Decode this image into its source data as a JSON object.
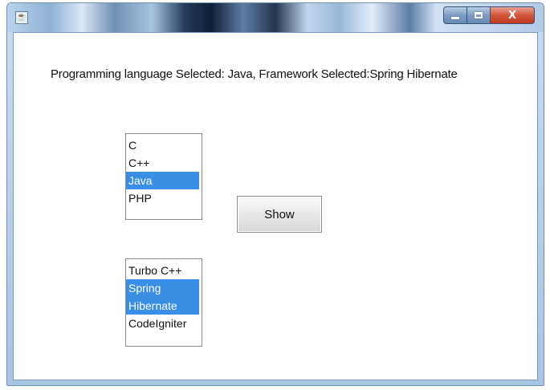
{
  "window": {
    "title_icon": "java-app-icon",
    "controls": {
      "minimize_icon": "minimize-icon",
      "maximize_icon": "maximize-icon",
      "close_icon": "close-icon",
      "close_label": "X"
    }
  },
  "status": {
    "text": "Programming language Selected: Java, Framework Selected:Spring Hibernate"
  },
  "language_list": {
    "items": [
      {
        "label": "C",
        "selected": false
      },
      {
        "label": "C++",
        "selected": false
      },
      {
        "label": "Java",
        "selected": true
      },
      {
        "label": "PHP",
        "selected": false
      }
    ]
  },
  "framework_list": {
    "items": [
      {
        "label": "Turbo C++",
        "selected": false
      },
      {
        "label": "Spring",
        "selected": true
      },
      {
        "label": "Hibernate",
        "selected": true
      },
      {
        "label": "CodeIgniter",
        "selected": false
      }
    ]
  },
  "show_button": {
    "label": "Show"
  },
  "colors": {
    "selection": "#3a8ee6",
    "selection_text": "#ffffff"
  }
}
